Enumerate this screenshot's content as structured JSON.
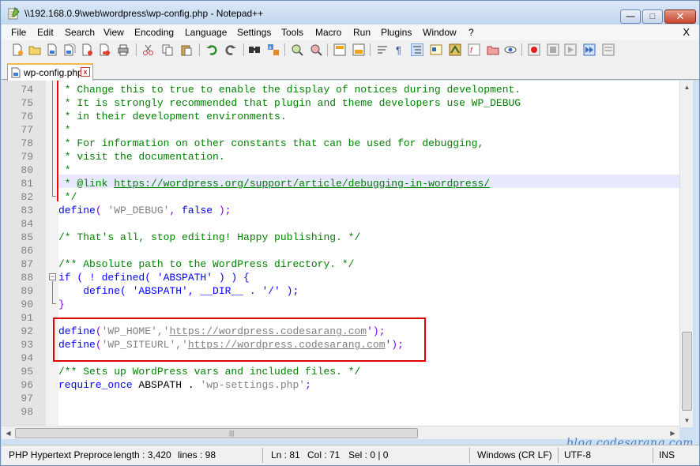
{
  "titlebar": {
    "title": "\\\\192.168.0.9\\web\\wordpress\\wp-config.php - Notepad++",
    "min_label": "—",
    "max_label": "□",
    "close_label": "✕"
  },
  "menu": {
    "items": [
      "File",
      "Edit",
      "Search",
      "View",
      "Encoding",
      "Language",
      "Settings",
      "Tools",
      "Macro",
      "Run",
      "Plugins",
      "Window",
      "?"
    ],
    "close": "X"
  },
  "toolbar": {
    "icons": [
      "new-file-icon",
      "open-file-icon",
      "save-icon",
      "save-all-icon",
      "close-icon",
      "close-all-icon",
      "print-icon",
      "cut-icon",
      "copy-icon",
      "paste-icon",
      "undo-icon",
      "redo-icon",
      "find-icon",
      "replace-icon",
      "zoom-in-icon",
      "zoom-out-icon",
      "sync-vertical-icon",
      "sync-horizontal-icon",
      "word-wrap-icon",
      "show-all-chars-icon",
      "indent-guide-icon",
      "user-defined-language-icon",
      "document-map-icon",
      "function-list-icon",
      "folder-as-workspace-icon",
      "monitoring-icon",
      "record-macro-icon",
      "stop-record-icon",
      "play-macro-icon",
      "run-macro-multiple-icon",
      "save-macro-icon"
    ]
  },
  "tab": {
    "label": "wp-config.php",
    "close": "x"
  },
  "editor": {
    "lines": [
      {
        "n": "74",
        "text": " * Change this to true to enable the display of notices during development."
      },
      {
        "n": "75",
        "text": " * It is strongly recommended that plugin and theme developers use WP_DEBUG"
      },
      {
        "n": "76",
        "text": " * in their development environments."
      },
      {
        "n": "77",
        "text": " *"
      },
      {
        "n": "78",
        "text": " * For information on other constants that can be used for debugging,"
      },
      {
        "n": "79",
        "text": " * visit the documentation."
      },
      {
        "n": "80",
        "text": " *"
      },
      {
        "n": "81",
        "text": " * @link ",
        "url": "https://wordpress.org/support/article/debugging-in-wordpress/"
      },
      {
        "n": "82",
        "text": " */"
      },
      {
        "n": "83",
        "kw": "define",
        "rest1": "( ",
        "str": "'WP_DEBUG'",
        "rest2": ", ",
        "kw2": "false",
        "rest3": " );"
      },
      {
        "n": "84",
        "text": ""
      },
      {
        "n": "85",
        "text": "/* That's all, stop editing! Happy publishing. */"
      },
      {
        "n": "86",
        "text": ""
      },
      {
        "n": "87",
        "text": "/** Absolute path to the WordPress directory. */"
      },
      {
        "n": "88",
        "text": "if ( ! defined( 'ABSPATH' ) ) {"
      },
      {
        "n": "89",
        "text": "    define( 'ABSPATH', __DIR__ . '/' );"
      },
      {
        "n": "90",
        "text": "}"
      },
      {
        "n": "91",
        "text": ""
      },
      {
        "n": "92",
        "kw": "define",
        "rest1": "(",
        "str": "'WP_HOME'",
        "rest2": ",'",
        "url": "https://wordpress.codesarang.com",
        "rest3": "');"
      },
      {
        "n": "93",
        "kw": "define",
        "rest1": "(",
        "str": "'WP_SITEURL'",
        "rest2": ",'",
        "url": "https://wordpress.codesarang.com",
        "rest3": "');"
      },
      {
        "n": "94",
        "text": ""
      },
      {
        "n": "95",
        "text": "/** Sets up WordPress vars and included files. */"
      },
      {
        "n": "96",
        "kw": "require_once",
        "rest1": " ABSPATH . ",
        "str": "'wp-settings.php'",
        "rest2": ";"
      },
      {
        "n": "97",
        "text": ""
      },
      {
        "n": "98",
        "text": ""
      }
    ]
  },
  "statusbar": {
    "language": "PHP Hypertext Preproce",
    "length": "length : 3,420",
    "lines": "lines : 98",
    "ln": "Ln : 81",
    "col": "Col : 71",
    "sel": "Sel : 0 | 0",
    "eol": "Windows (CR LF)",
    "encoding": "UTF-8",
    "mode": "INS"
  },
  "watermark": "blog.codesarang.com",
  "colors": {
    "comment": "#008000",
    "keyword": "#0000ff",
    "string": "#808080",
    "highlight_box": "#e00000",
    "current_line": "#e8e8ff"
  }
}
